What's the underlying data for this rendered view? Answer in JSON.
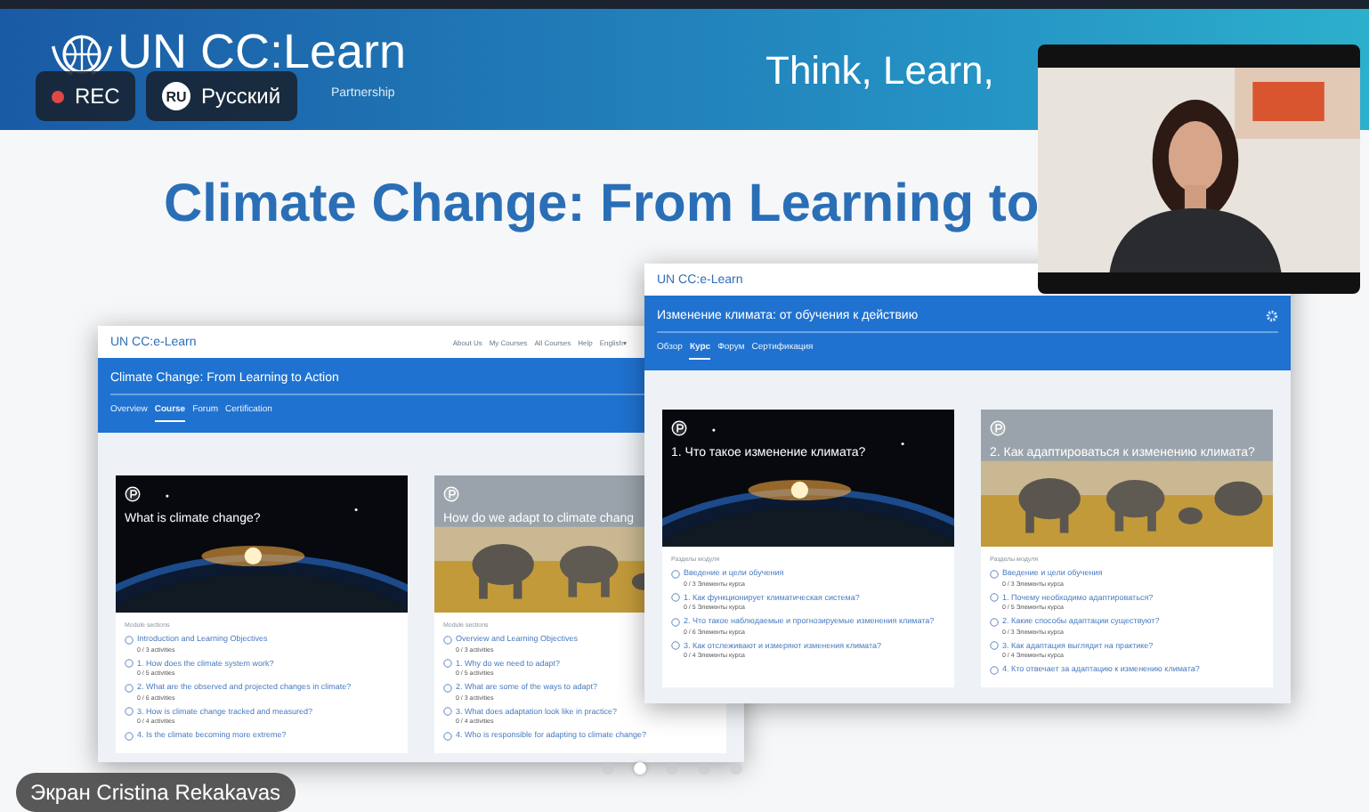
{
  "recording": {
    "label": "REC"
  },
  "language": {
    "code": "RU",
    "label": "Русский"
  },
  "slide": {
    "logo": "UN CC:Learn",
    "tagline": "Partnership",
    "motto": "Think, Learn,",
    "title": "Climate Change: From Learning to",
    "windows": [
      {
        "logo": "UN CC:e-Learn",
        "nav": [
          "About Us",
          "My Courses",
          "All Courses",
          "Help",
          "English▾"
        ],
        "course_title": "Climate Change: From Learning to Action",
        "tabs": [
          {
            "label": "Overview",
            "selected": false
          },
          {
            "label": "Course",
            "selected": true
          },
          {
            "label": "Forum",
            "selected": false
          },
          {
            "label": "Certification",
            "selected": false
          }
        ],
        "cards": [
          {
            "title": "What is climate change?",
            "section_label": "Module sections",
            "sections": [
              {
                "title": "Introduction and Learning Objectives",
                "meta": "0 / 3 activities"
              },
              {
                "title": "1. How does the climate system work?",
                "meta": "0 / 5 activities"
              },
              {
                "title": "2. What are the observed and projected changes in climate?",
                "meta": "0 / 6 activities"
              },
              {
                "title": "3. How is climate change tracked and measured?",
                "meta": "0 / 4 activities"
              },
              {
                "title": "4. Is the climate becoming more extreme?"
              }
            ]
          },
          {
            "title": "How do we adapt to climate chang",
            "section_label": "Module sections",
            "sections": [
              {
                "title": "Overview and Learning Objectives",
                "meta": "0 / 3 activities"
              },
              {
                "title": "1. Why do we need to adapt?",
                "meta": "0 / 5 activities"
              },
              {
                "title": "2. What are some of the ways to adapt?",
                "meta": "0 / 3 activities"
              },
              {
                "title": "3. What does adaptation look like in practice?",
                "meta": "0 / 4 activities"
              },
              {
                "title": "4. Who is responsible for adapting to climate change?"
              }
            ]
          }
        ]
      },
      {
        "logo": "UN CC:e-Learn",
        "settings_icon": true,
        "course_title": "Изменение климата: от обучения к действию",
        "tabs": [
          {
            "label": "Обзор",
            "selected": false
          },
          {
            "label": "Курс",
            "selected": true
          },
          {
            "label": "Форум",
            "selected": false
          },
          {
            "label": "Сертификация",
            "selected": false
          }
        ],
        "cards": [
          {
            "title": "1. Что такое изменение климата?",
            "section_label": "Разделы модуля",
            "sections": [
              {
                "title": "Введение и цели обучения",
                "meta": "0 / 3 Элементы курса"
              },
              {
                "title": "1. Как функционирует климатическая система?",
                "meta": "0 / 5 Элементы курса"
              },
              {
                "title": "2. Что такое наблюдаемые и прогнозируемые изменения климата?",
                "meta": "0 / 6 Элементы курса"
              },
              {
                "title": "3. Как отслеживают и измеряют изменения климата?",
                "meta": "0 / 4 Элементы курса"
              }
            ]
          },
          {
            "title": "2. Как адаптироваться к изменению климата?",
            "section_label": "Разделы модуля",
            "sections": [
              {
                "title": "Введение и цели обучения",
                "meta": "0 / 3 Элементы курса"
              },
              {
                "title": "1. Почему необходимо адаптироваться?",
                "meta": "0 / 5 Элементы курса"
              },
              {
                "title": "2. Какие способы адаптации существуют?",
                "meta": "0 / 3 Элементы курса"
              },
              {
                "title": "3. Как адаптация выглядит на практике?",
                "meta": "0 / 4 Элементы курса"
              },
              {
                "title": "4. Кто отвечает за адаптацию к изменению климата?"
              }
            ]
          }
        ]
      }
    ]
  },
  "screen_label": "Экран Cristina Rekakavas",
  "pages": [
    {
      "selected": false
    },
    {
      "selected": true
    },
    {
      "selected": false
    },
    {
      "selected": false
    },
    {
      "selected": false
    }
  ]
}
